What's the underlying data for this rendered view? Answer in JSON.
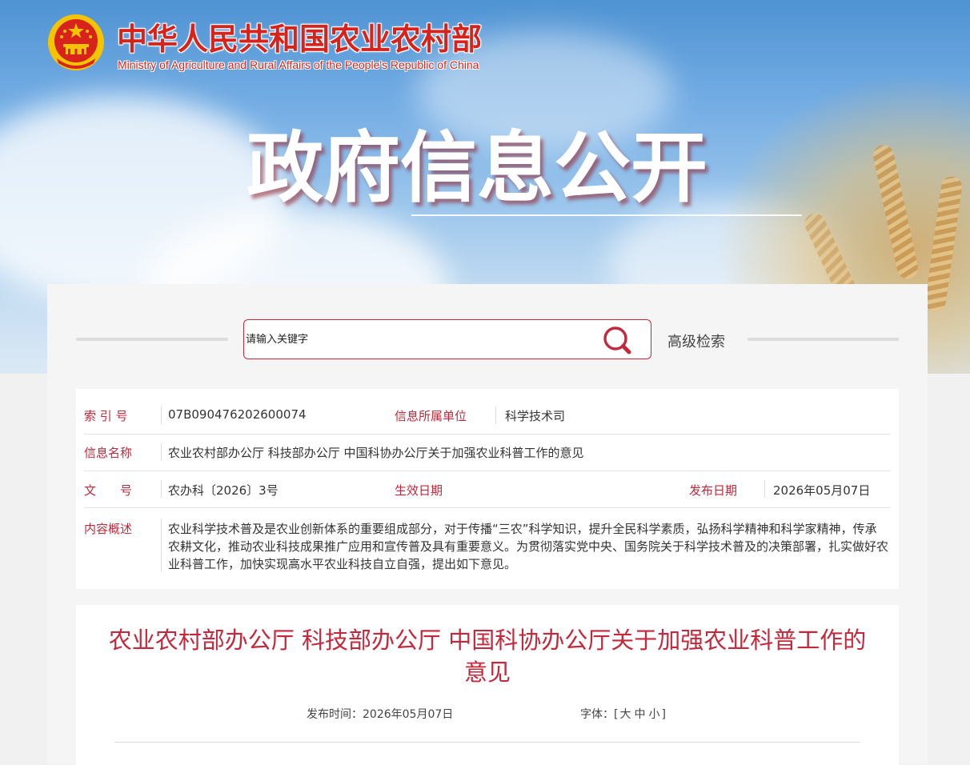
{
  "header": {
    "site_title_cn": "中华人民共和国农业农村部",
    "site_title_en": "Ministry of Agriculture and Rural Affairs of the People's Republic of China",
    "hero_title": "政府信息公开"
  },
  "search": {
    "placeholder": "请输入关键字",
    "advanced_label": "高级检索",
    "icon": "search-icon"
  },
  "info": {
    "index_label": "索 引 号",
    "index_value": "07B090476202600074",
    "unit_label": "信息所属单位",
    "unit_value": "科学技术司",
    "name_label": "信息名称",
    "name_value": "农业农村部办公厅 科技部办公厅 中国科协办公厅关于加强农业科普工作的意见",
    "docno_label": "文　　号",
    "docno_value": "农办科〔2026〕3号",
    "effective_label": "生效日期",
    "effective_value": "",
    "publish_label": "发布日期",
    "publish_value": "2026年05月07日",
    "summary_label": "内容概述",
    "summary_value": "农业科学技术普及是农业创新体系的重要组成部分，对于传播“三农”科学知识，提升全民科学素质，弘扬科学精神和科学家精神，传承农耕文化，推动农业科技成果推广应用和宣传普及具有重要意义。为贯彻落实党中央、国务院关于科学技术普及的决策部署，扎实做好农业科普工作，加快实现高水平农业科技自立自强，提出如下意见。"
  },
  "article": {
    "title": "农业农村部办公厅 科技部办公厅 中国科协办公厅关于加强农业科普工作的意见",
    "publish_time_label": "发布时间：",
    "publish_time_value": "2026年05月07日",
    "font_label": "字体：",
    "font_open": "[",
    "font_large": "大",
    "font_medium": "中",
    "font_small": "小",
    "font_close": "]"
  },
  "colors": {
    "brand_red": "#c4283a",
    "emblem_red": "#d7231b",
    "emblem_gold": "#f5c400"
  }
}
